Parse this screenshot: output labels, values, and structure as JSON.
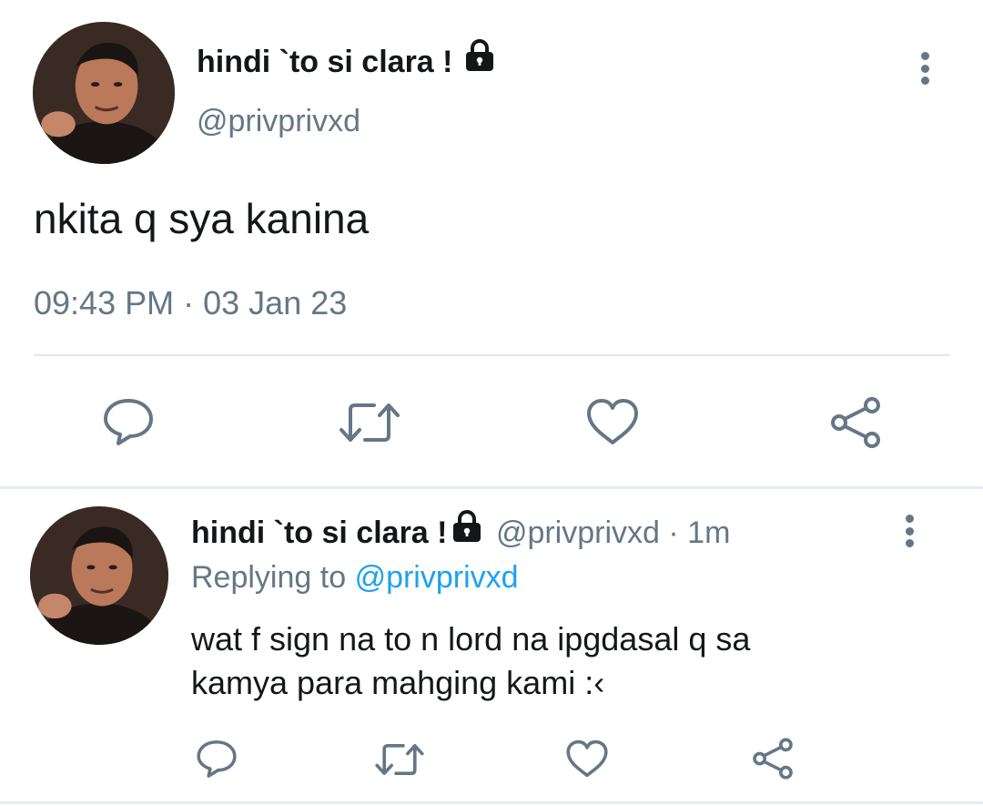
{
  "main_tweet": {
    "display_name": "hindi `to si clara !",
    "handle": "@privprivxd",
    "text": "nkita q sya kanina",
    "time": "09:43 PM",
    "separator": "·",
    "date": "03 Jan 23",
    "protected_icon": "lock-icon",
    "more_icon": "more-vertical-icon"
  },
  "actions": {
    "reply_icon": "reply-icon",
    "retweet_icon": "retweet-icon",
    "like_icon": "heart-icon",
    "share_icon": "share-icon"
  },
  "reply_tweet": {
    "display_name": "hindi `to si clara !",
    "handle": "@privprivxd",
    "separator": "·",
    "time_ago": "1m",
    "replying_prefix": "Replying to",
    "replying_handle": "@privprivxd",
    "text_line1": "wat f sign na to n lord na ipgdasal q sa",
    "text_line2": "kamya para mahging kami :‹"
  },
  "colors": {
    "text": "#14171a",
    "muted": "#657786",
    "link": "#1da1f2",
    "divider": "#e1e8ed"
  }
}
